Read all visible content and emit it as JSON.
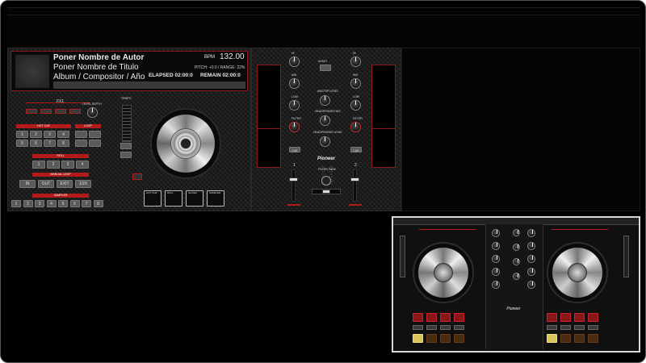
{
  "track": {
    "artist": "Poner Nombre de Autor",
    "title": "Poner Nombre de Titulo",
    "album": "Album / Compositor / Año",
    "bpm_label": "BPM",
    "bpm_value": "132.00",
    "pitch_range": "PITCH: +0.0 / RANGE: 22%",
    "elapsed": "ELAPSED 02:00:0",
    "remain": "REMAIN 02:00:0"
  },
  "deck": {
    "fx_label": "FX1",
    "level_depth_label": "LEVEL DEPTH",
    "hot_cue_label": "HOT CUE",
    "loop_label": "LOOP",
    "sampler_label": "SAMPLER",
    "tempo_label": "TEMPO",
    "keypad": [
      "1",
      "2",
      "3",
      "4",
      "5",
      "6",
      "7",
      "8"
    ],
    "roll_label": "ROLL",
    "roll_pads": [
      "1",
      "2",
      "3",
      "4"
    ],
    "manual_loop_label": "MANUAL LOOP",
    "loop_buttons": [
      "IN",
      "OUT",
      "EXIT",
      "1/2X"
    ],
    "sampler_pads": [
      "1",
      "2",
      "3",
      "4",
      "5",
      "6",
      "7",
      "8"
    ],
    "mode_buttons": [
      "HOT CUE",
      "ROLL",
      "SLICER",
      "SAMPLER"
    ]
  },
  "mixer": {
    "brand": "Pioneer",
    "master_level": "MASTER LEVEL",
    "headphones_mix": "HEADPHONES MIX",
    "headphones_level": "HEADPHONES LEVEL",
    "filter_fade": "FILTER FADE",
    "ch1": "1",
    "ch2": "2",
    "labels": [
      "HI",
      "MID",
      "LOW",
      "FILTER",
      "CUE"
    ]
  },
  "colors": {
    "accent_red": "#b31b1b",
    "background": "#000000",
    "panel": "#1b1b1b"
  }
}
